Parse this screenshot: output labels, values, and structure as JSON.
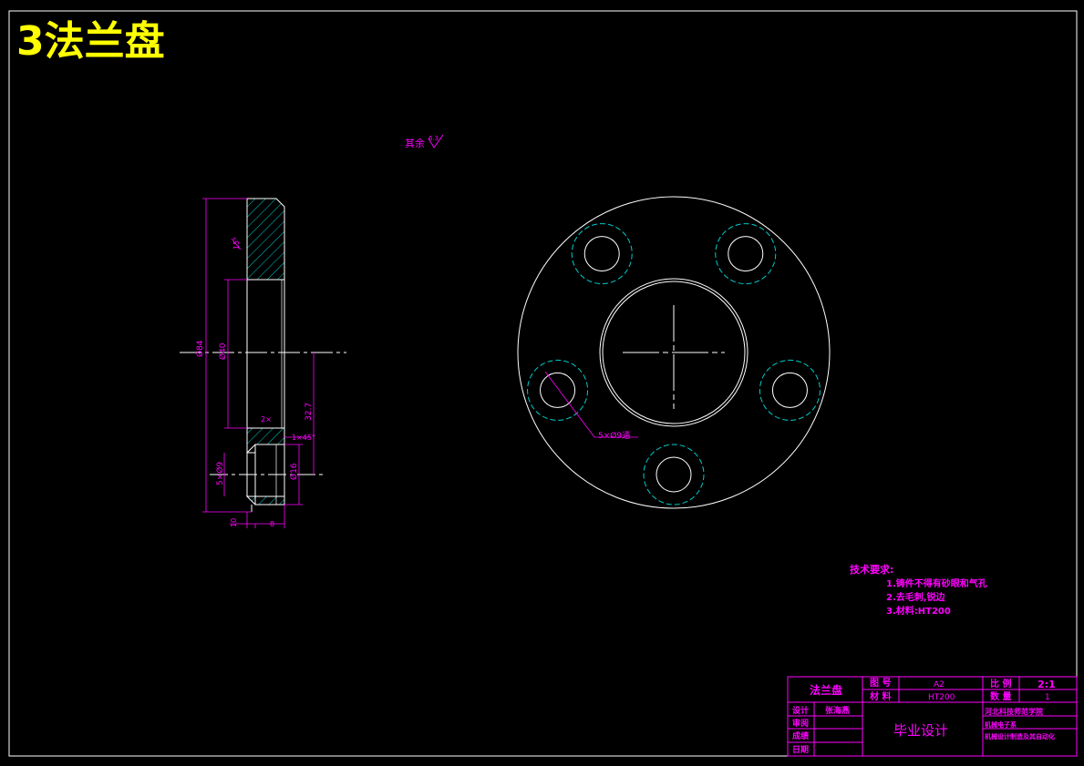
{
  "title": "3法兰盘",
  "roughness_note": {
    "label": "其余",
    "value": "6.3"
  },
  "side_view": {
    "dims": {
      "outer_dia": "Ø84",
      "inner_dia": "Ø40",
      "chamfer_angle": "15°",
      "offset": "32.7",
      "counterbore_angle": "2×",
      "chamfer": "1×45°",
      "hole_dia": "Ø16",
      "hole_pattern": "5×Ø9",
      "thickness_a": "10",
      "thickness_b": "8"
    }
  },
  "front_view": {
    "callout": "5×Ø9通"
  },
  "tech_req": {
    "heading": "技术要求:",
    "items": [
      "1.铸件不得有砂眼和气孔",
      "2.去毛刺,锐边",
      "3.材料:HT200"
    ]
  },
  "title_block": {
    "part_name": "法兰盘",
    "drawing_no_label": "图 号",
    "drawing_no": "A2",
    "material_label": "材 料",
    "material": "HT200",
    "scale_label": "比 例",
    "scale": "2:1",
    "qty_label": "数 量",
    "qty": "1",
    "design_label": "设计",
    "designer": "张海燕",
    "review_label": "审阅",
    "grade_label": "成绩",
    "date_label": "日期",
    "project": "毕业设计",
    "school": "河北科技师范学院",
    "dept": "机械电子系",
    "major": "机械设计制造及其自动化"
  },
  "colors": {
    "line": "#ffffff",
    "dim": "#ff00ff",
    "hatch": "#00cccc",
    "hidden": "#00cccc",
    "title": "#ffff00"
  }
}
